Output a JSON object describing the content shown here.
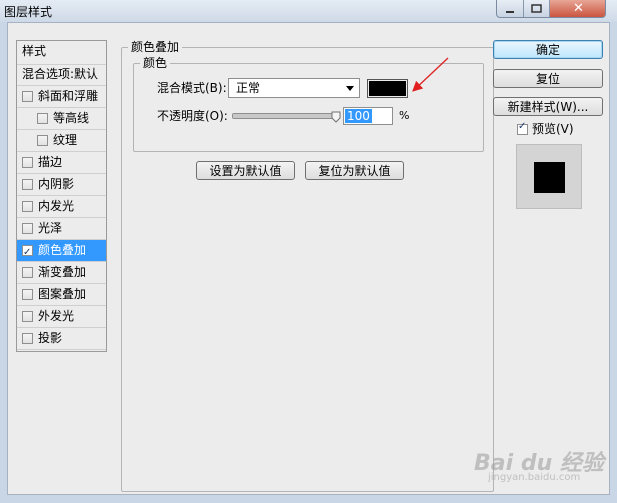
{
  "window": {
    "title": "图层样式",
    "close_glyph": "✕"
  },
  "style_list": {
    "header": "样式",
    "items": [
      {
        "label": "混合选项:默认",
        "checkbox": false,
        "checked": false,
        "indent": false,
        "selected": false
      },
      {
        "label": "斜面和浮雕",
        "checkbox": true,
        "checked": false,
        "indent": false,
        "selected": false
      },
      {
        "label": "等高线",
        "checkbox": true,
        "checked": false,
        "indent": true,
        "selected": false
      },
      {
        "label": "纹理",
        "checkbox": true,
        "checked": false,
        "indent": true,
        "selected": false
      },
      {
        "label": "描边",
        "checkbox": true,
        "checked": false,
        "indent": false,
        "selected": false
      },
      {
        "label": "内阴影",
        "checkbox": true,
        "checked": false,
        "indent": false,
        "selected": false
      },
      {
        "label": "内发光",
        "checkbox": true,
        "checked": false,
        "indent": false,
        "selected": false
      },
      {
        "label": "光泽",
        "checkbox": true,
        "checked": false,
        "indent": false,
        "selected": false
      },
      {
        "label": "颜色叠加",
        "checkbox": true,
        "checked": true,
        "indent": false,
        "selected": true
      },
      {
        "label": "渐变叠加",
        "checkbox": true,
        "checked": false,
        "indent": false,
        "selected": false
      },
      {
        "label": "图案叠加",
        "checkbox": true,
        "checked": false,
        "indent": false,
        "selected": false
      },
      {
        "label": "外发光",
        "checkbox": true,
        "checked": false,
        "indent": false,
        "selected": false
      },
      {
        "label": "投影",
        "checkbox": true,
        "checked": false,
        "indent": false,
        "selected": false
      }
    ]
  },
  "panel": {
    "group_title": "颜色叠加",
    "subgroup_title": "颜色",
    "blend_mode_label": "混合模式(B):",
    "blend_mode_value": "正常",
    "color_swatch": "#000000",
    "opacity_label": "不透明度(O):",
    "opacity_value": "100",
    "opacity_unit": "%",
    "opacity_level": 100,
    "set_default_label": "设置为默认值",
    "reset_default_label": "复位为默认值"
  },
  "actions": {
    "ok_label": "确定",
    "reset_label": "复位",
    "new_style_label": "新建样式(W)...",
    "preview_label": "预览(V)",
    "preview_checked": true,
    "preview_swatch": "#000000"
  },
  "annotation": {
    "arrow_color": "#e02020"
  },
  "watermark": {
    "text": "Bai du 经验",
    "subtext": "jingyan.baidu.com"
  }
}
